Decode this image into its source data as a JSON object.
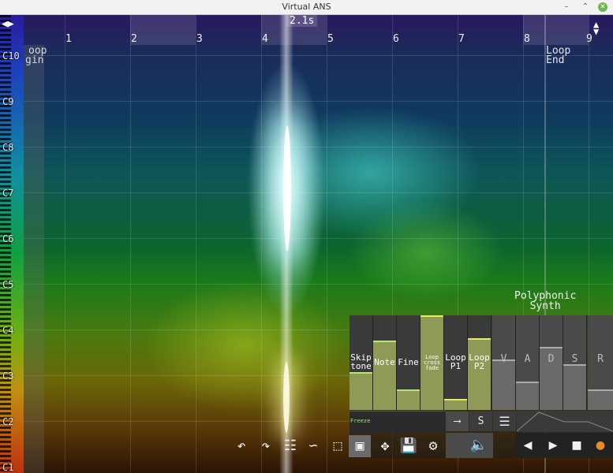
{
  "window": {
    "title": "Virtual ANS"
  },
  "ruler": {
    "time_display": "2.1s",
    "marks": [
      "1",
      "2",
      "3",
      "4",
      "5",
      "6",
      "7",
      "8",
      "9"
    ],
    "left_nav_icon": "left-right-arrows-icon",
    "right_nav_icon": "up-down-arrows-icon"
  },
  "octaves": [
    "C10",
    "C9",
    "C8",
    "C7",
    "C6",
    "C5",
    "C4",
    "C3",
    "C2",
    "C1"
  ],
  "loop": {
    "begin_label_line1": "oop",
    "begin_label_line2": "gin",
    "end_label_line1": "Loop",
    "end_label_line2": "End"
  },
  "synth": {
    "mode_line1": "Polyphonic",
    "mode_line2": "Synth",
    "controls": [
      {
        "label1": "Skip",
        "label2": "tone",
        "level": 0.38
      },
      {
        "label1": "Note",
        "label2": "",
        "level": 0.72
      },
      {
        "label1": "Fine",
        "label2": "",
        "level": 0.2
      },
      {
        "label1": "Loop",
        "label2": "cross fade",
        "level": 0.98
      },
      {
        "label1": "Loop",
        "label2": "P1",
        "level": 0.1
      },
      {
        "label1": "Loop",
        "label2": "P2",
        "level": 0.74
      }
    ],
    "adsr": [
      {
        "label": "V",
        "level": 0.65
      },
      {
        "label": "A",
        "level": 0.42
      },
      {
        "label": "D",
        "level": 0.82
      },
      {
        "label": "S",
        "level": 0.6
      },
      {
        "label": "R",
        "level": 0.38
      }
    ],
    "freeze_label": "Freeze",
    "s_label": "S",
    "arrow_icon": "arrow-right-bar-icon",
    "menu_icon": "hamburger-icon"
  },
  "toolbar": {
    "undo_icon": "undo-icon",
    "redo_icon": "redo-icon",
    "mixer_icon": "mixer-icon",
    "curve_icon": "curve-icon",
    "select_icon": "select-rect-icon",
    "fill_icon": "fill-rect-icon",
    "move_icon": "move-icon",
    "save_icon": "save-icon",
    "settings_icon": "gear-icon",
    "volume_icon": "speaker-icon"
  },
  "transport": {
    "prev_icon": "play-backward-icon",
    "play_icon": "play-icon",
    "stop_icon": "stop-icon",
    "record_icon": "record-icon"
  },
  "colors": {
    "control_fill": "#8f9a57",
    "control_cap": "#b8e878",
    "record": "#e88a2a"
  }
}
